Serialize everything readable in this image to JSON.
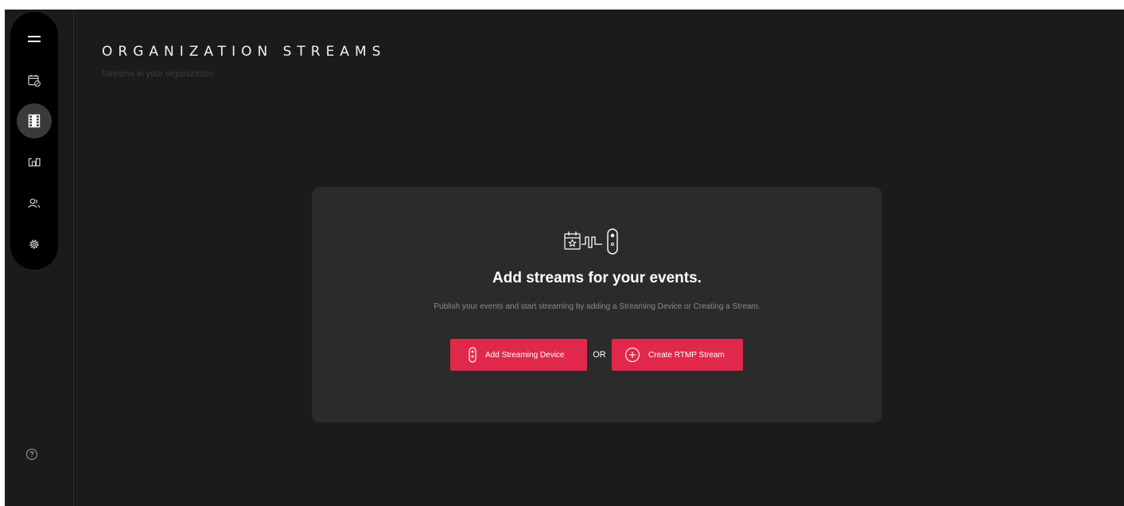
{
  "page": {
    "title": "ORGANIZATION STREAMS",
    "subtitle": "Streams in your organization"
  },
  "sidebar": {
    "items": [
      {
        "icon": "menu-icon",
        "active": false
      },
      {
        "icon": "calendar-icon",
        "active": false
      },
      {
        "icon": "film-icon",
        "active": true
      },
      {
        "icon": "devices-icon",
        "active": false
      },
      {
        "icon": "users-icon",
        "active": false
      },
      {
        "icon": "gear-icon",
        "active": false
      }
    ],
    "help_icon": "help-icon"
  },
  "empty_state": {
    "icon": "calendar-signal-device-icon",
    "title": "Add streams for your events.",
    "description": "Publish your events and start streaming by adding a Streaming Device or Creating a Stream.",
    "primary_button": "Add Streaming Device",
    "or_label": "OR",
    "secondary_button": "Create RTMP Stream"
  },
  "colors": {
    "background": "#1b1b1b",
    "rail": "#000000",
    "card": "#2b2b2b",
    "accent": "#e0284a",
    "text": "#ffffff",
    "muted": "#8a8a8a"
  }
}
